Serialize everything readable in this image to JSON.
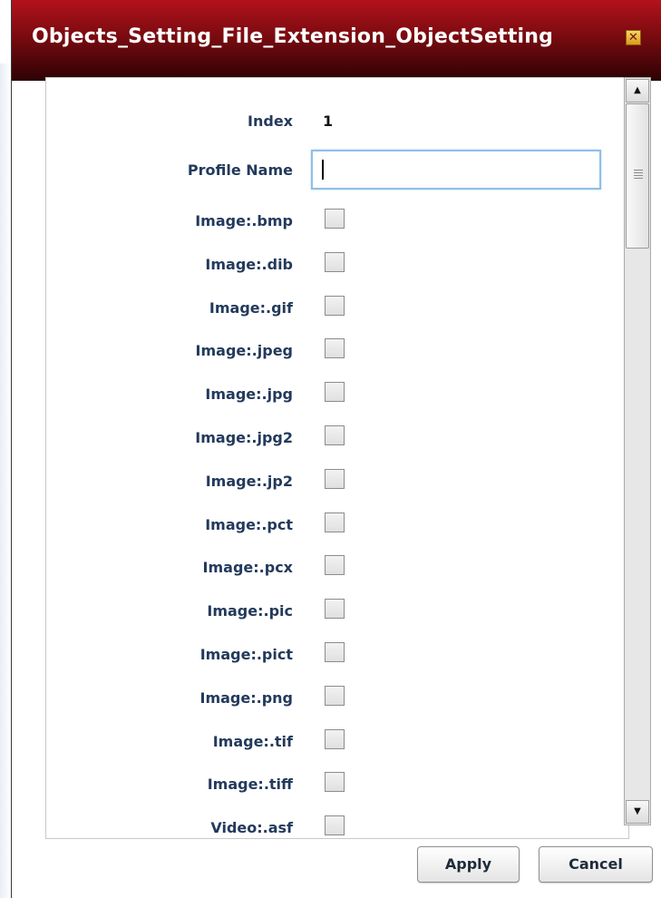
{
  "dialog": {
    "title": "Objects_Setting_File_Extension_ObjectSetting",
    "close_label": "✕"
  },
  "form": {
    "index_label": "Index",
    "index_value": "1",
    "profile_name_label": "Profile Name",
    "profile_name_value": "",
    "extensions": [
      {
        "label": "Image:.bmp",
        "checked": false
      },
      {
        "label": "Image:.dib",
        "checked": false
      },
      {
        "label": "Image:.gif",
        "checked": false
      },
      {
        "label": "Image:.jpeg",
        "checked": false
      },
      {
        "label": "Image:.jpg",
        "checked": false
      },
      {
        "label": "Image:.jpg2",
        "checked": false
      },
      {
        "label": "Image:.jp2",
        "checked": false
      },
      {
        "label": "Image:.pct",
        "checked": false
      },
      {
        "label": "Image:.pcx",
        "checked": false
      },
      {
        "label": "Image:.pic",
        "checked": false
      },
      {
        "label": "Image:.pict",
        "checked": false
      },
      {
        "label": "Image:.png",
        "checked": false
      },
      {
        "label": "Image:.tif",
        "checked": false
      },
      {
        "label": "Image:.tiff",
        "checked": false
      },
      {
        "label": "Video:.asf",
        "checked": false
      }
    ]
  },
  "scrollbar": {
    "up_arrow": "▲",
    "down_arrow": "▼"
  },
  "footer": {
    "apply_label": "Apply",
    "cancel_label": "Cancel"
  },
  "colors": {
    "titlebar_top": "#b3121b",
    "titlebar_bottom": "#2f0204",
    "label_text": "#233a5c"
  }
}
